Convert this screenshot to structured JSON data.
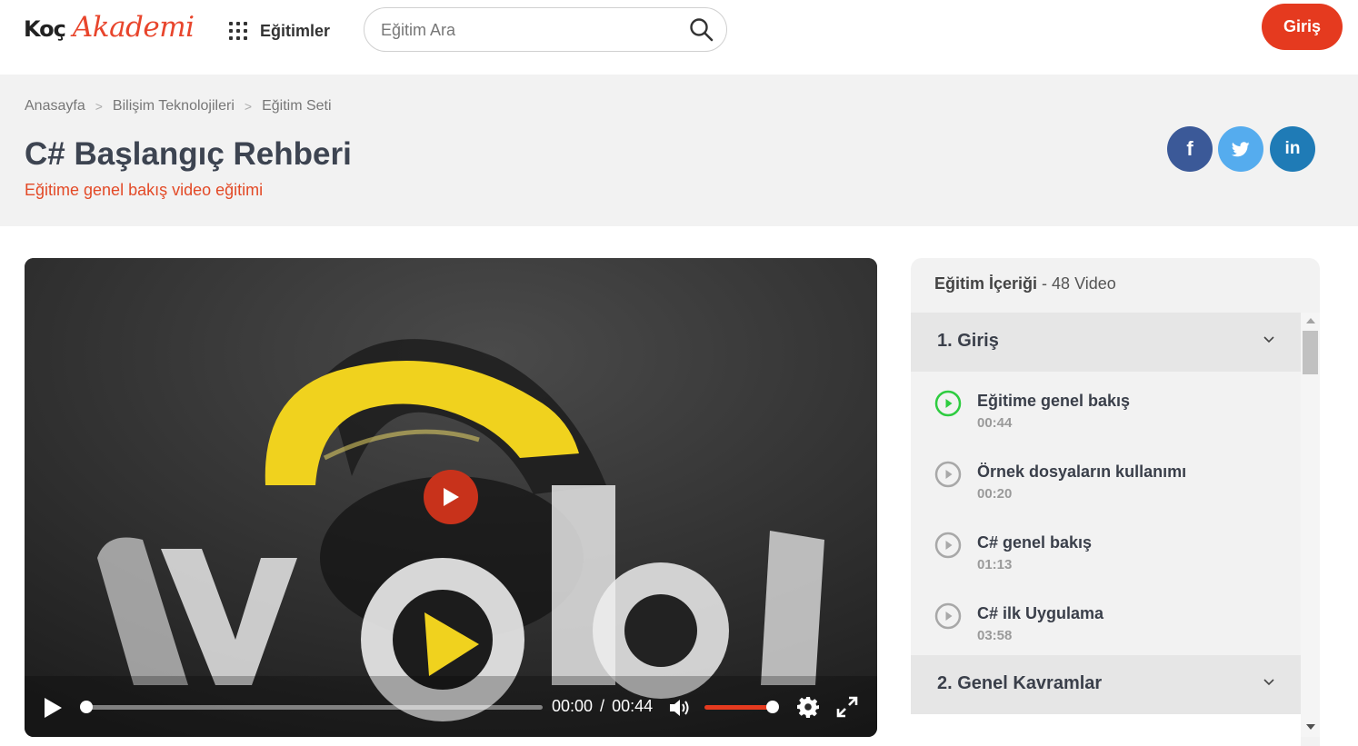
{
  "header": {
    "logo_part1": "Koç",
    "logo_part2": "Akademi",
    "nav_label": "Eğitimler",
    "search_placeholder": "Eğitim Ara",
    "login_label": "Giriş"
  },
  "breadcrumb": [
    "Anasayfa",
    "Bilişim Teknolojileri",
    "Eğitim Seti"
  ],
  "page": {
    "title": "C# Başlangıç Rehberi",
    "subtitle": "Eğitime genel bakış video eğitimi"
  },
  "share": {
    "facebook_label": "f",
    "linkedin_label": "in"
  },
  "player": {
    "current_time": "00:00",
    "separator": "/",
    "duration": "00:44",
    "progress": 0,
    "volume": 1.0
  },
  "course": {
    "header_label": "Eğitim İçeriği",
    "header_count": "- 48 Video",
    "sections": [
      {
        "title": "1. Giriş",
        "lessons": [
          {
            "title": "Eğitime genel bakış",
            "duration": "00:44",
            "active": true
          },
          {
            "title": "Örnek dosyaların kullanımı",
            "duration": "00:20",
            "active": false
          },
          {
            "title": "C# genel bakış",
            "duration": "01:13",
            "active": false
          },
          {
            "title": "C# ilk Uygulama",
            "duration": "03:58",
            "active": false
          }
        ]
      },
      {
        "title": "2. Genel Kavramlar",
        "lessons": []
      }
    ]
  },
  "colors": {
    "accent": "#e53a1f",
    "active_lesson": "#2ecc40",
    "facebook": "#3b5998",
    "twitter": "#55acee",
    "linkedin": "#1f7bb6"
  }
}
